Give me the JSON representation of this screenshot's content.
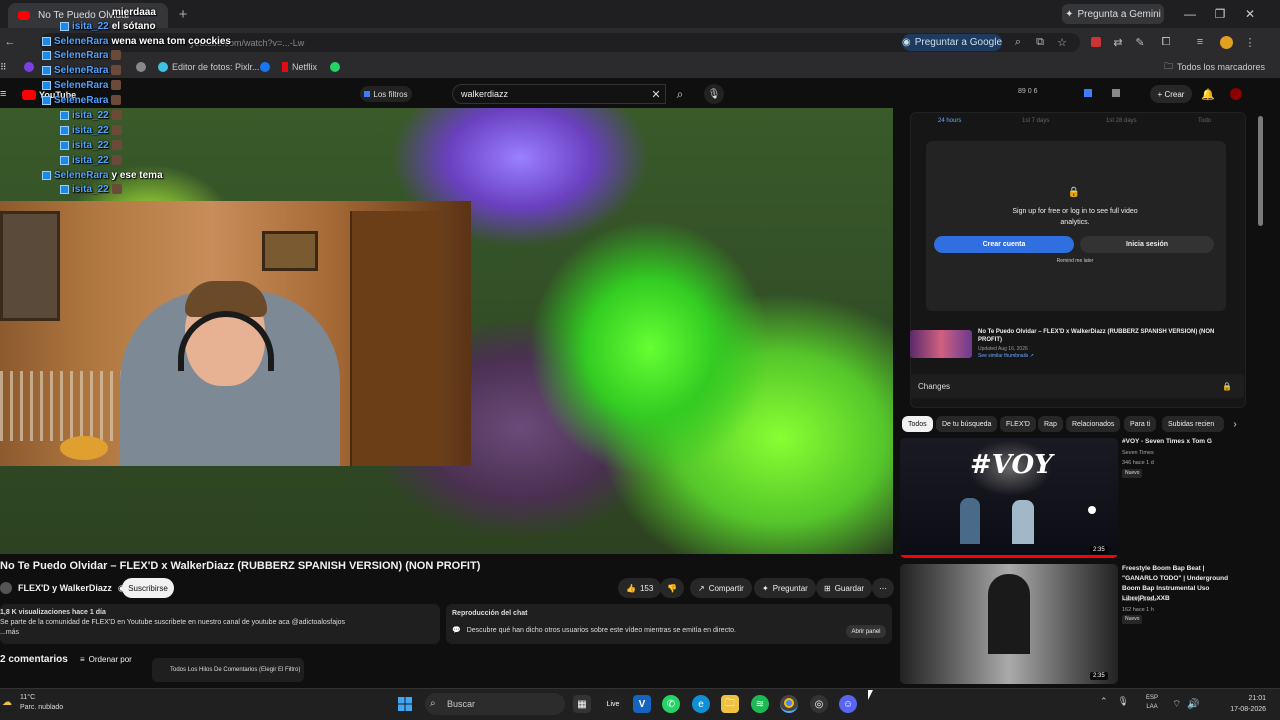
{
  "browser": {
    "tab_title": "No Te Puedo Olvidar",
    "gemini": "Pregunta a Gemini",
    "url": "youtube.com/watch?v=...-Lw",
    "preguntar_google": "Preguntar a Google",
    "bookmarks": [
      "Editor de fotos: Pixlr...",
      "Netflix"
    ],
    "all_bookmarks": "Todos los marcadores"
  },
  "chat_overlay": [
    {
      "user": "",
      "msg": "mierdaaa",
      "emote": false
    },
    {
      "user": "isita_22",
      "msg": "el sótano",
      "emote": false
    },
    {
      "user": "SeleneRara",
      "msg": "wena wena tom coockies",
      "emote": false
    },
    {
      "user": "SeleneRara",
      "msg": "",
      "emote": true
    },
    {
      "user": "SeleneRara",
      "msg": "",
      "emote": true
    },
    {
      "user": "SeleneRara",
      "msg": "",
      "emote": true
    },
    {
      "user": "SeleneRara",
      "msg": "",
      "emote": true
    },
    {
      "user": "isita_22",
      "msg": "",
      "emote": true
    },
    {
      "user": "isita_22",
      "msg": "",
      "emote": true
    },
    {
      "user": "isita_22",
      "msg": "",
      "emote": true
    },
    {
      "user": "isita_22",
      "msg": "",
      "emote": true
    },
    {
      "user": "SeleneRara",
      "msg": "y ese tema",
      "emote": false
    },
    {
      "user": "isita_22",
      "msg": "",
      "emote": true
    }
  ],
  "youtube": {
    "logo": "YouTube",
    "filters": "Los filtros",
    "search_value": "walkerdiazz",
    "stats": "89  0  6",
    "create": "+ Crear"
  },
  "video": {
    "title": "No Te Puedo Olvidar – FLEX'D x WalkerDiazz (RUBBERZ SPANISH VERSION) (NON PROFIT)",
    "channel": "FLEX'D y WalkerDiazz",
    "subscribe": "Suscribirse",
    "likes": "153",
    "share": "Compartir",
    "ask": "Preguntar",
    "save": "Guardar",
    "views": "1,8 K visualizaciones  hace 1 día",
    "description": "Se parte de la comunidad de FLEX'D en Youtube suscribete en nuestro canal de youtube aca  @adictoalosfajos",
    "more": "...más",
    "chat_replay_title": "Reproducción del chat",
    "chat_replay_desc": "Descubre qué han dicho otros usuarios sobre este vídeo mientras se emitía en directo.",
    "open_panel": "Abrir panel",
    "comments": "2 comentarios",
    "sort": "Ordenar por",
    "threads": "Todos Los Hilos De Comentarios (Elegir El Filtro)"
  },
  "analytics": {
    "tabs": [
      "24 hours",
      "1st 7 days",
      "1st 28 days",
      "Todo"
    ],
    "signup_text": "Sign up for free or log in to see full video analytics.",
    "crear_cuenta": "Crear cuenta",
    "inicia_sesion": "Inicia sesión",
    "remind": "Remind me later",
    "video_title": "No Te Puedo Olvidar – FLEX'D x WalkerDiazz (RUBBERZ SPANISH VERSION) (NON PROFIT)",
    "video_updated": "Updated Aug 16, 2026",
    "similar": "See similar thumbnails ↗",
    "changes": "Changes"
  },
  "chips": [
    "Todos",
    "De tu búsqueda",
    "FLEX'D",
    "Rap",
    "Relacionados",
    "Para ti",
    "Subidas recien"
  ],
  "recommended": [
    {
      "title": "#VOY - Seven Times x Tom G",
      "channel": "Seven Times",
      "meta": "346  hace 1 d",
      "badge": "Nuevo",
      "duration": "2:35",
      "thumb_text": "#VOY"
    },
    {
      "title": "Freestyle Boom Bap Beat | \"GANARLO TODO\" | Underground Boom Bap Instrumental Uso Libre|Prod.XXB",
      "channel": "XavierX Beatz",
      "meta": "162  hace 1 h",
      "badge": "Nuevo",
      "duration": "2:35"
    }
  ],
  "taskbar": {
    "temp": "11°C",
    "weather": "Parc. nublado",
    "search": "Buscar",
    "lang1": "ESP",
    "lang2": "LAA",
    "time": "21:01",
    "date": "17-08-2026"
  },
  "colors": {
    "accent": "#2f6fe0",
    "yt_red": "#ff0000",
    "chat_nick": "#4fa3ff"
  }
}
